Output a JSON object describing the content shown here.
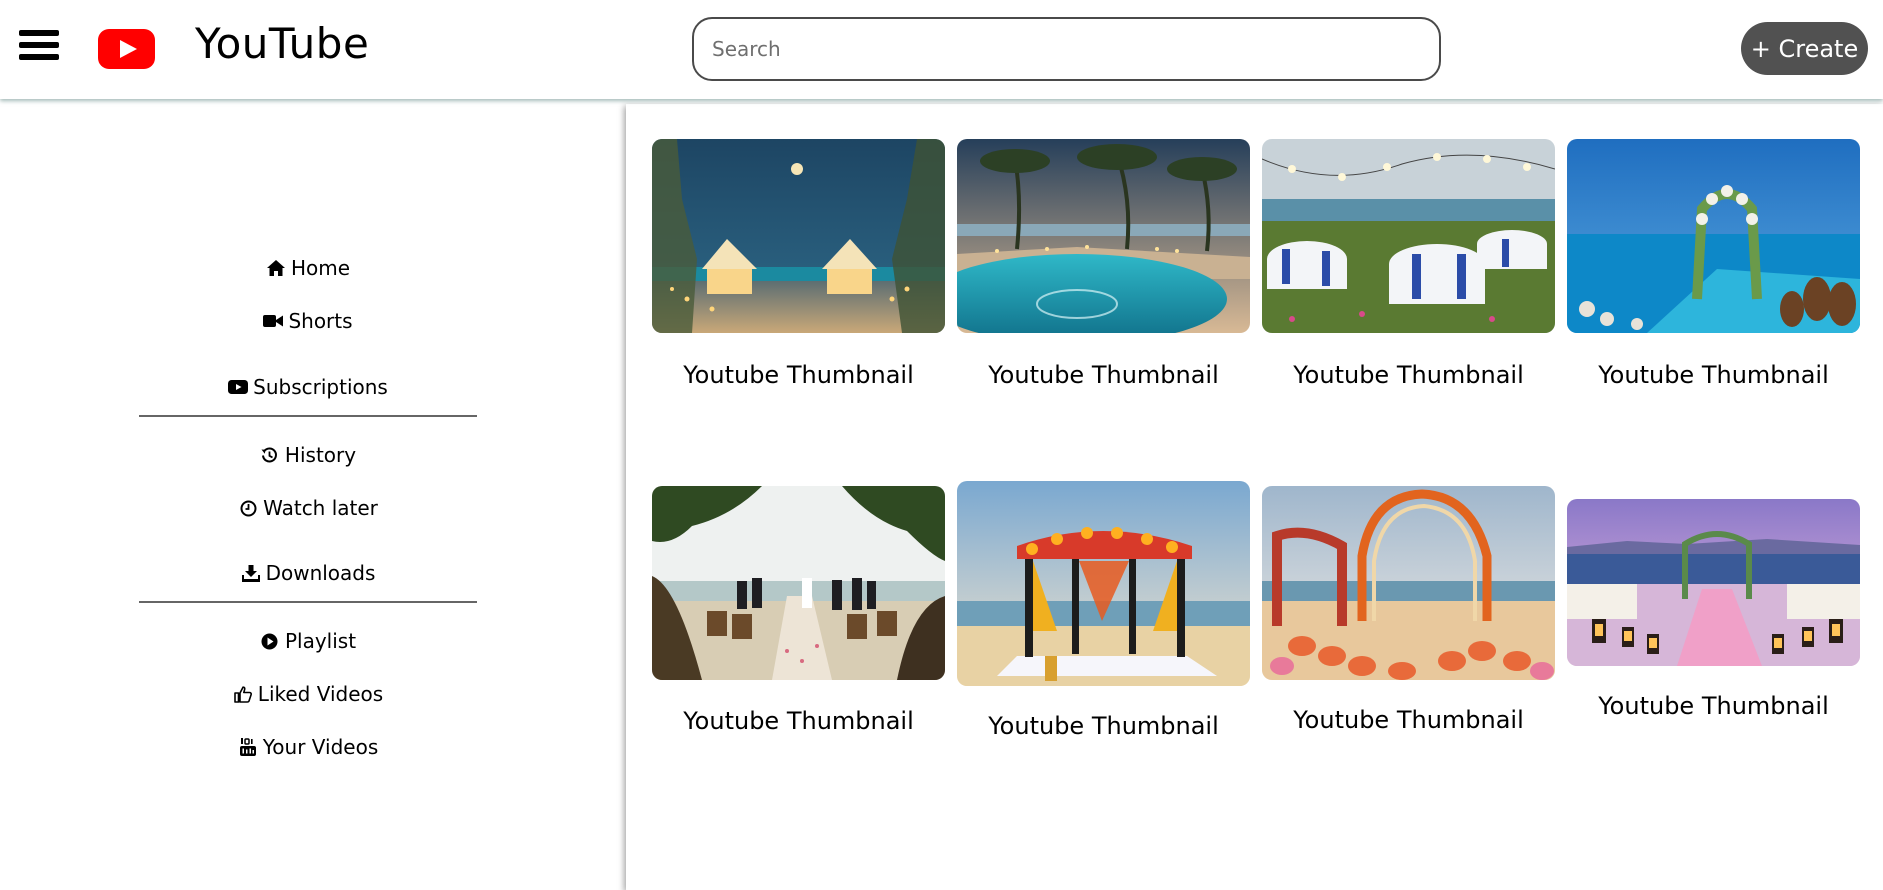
{
  "header": {
    "brand": "YouTube",
    "search_placeholder": "Search",
    "search_value": "",
    "create_label": "+ Create"
  },
  "sidebar": {
    "items": [
      {
        "label": "Home",
        "icon": "home-icon"
      },
      {
        "label": "Shorts",
        "icon": "video-camera-icon"
      },
      {
        "label": "Subscriptions",
        "icon": "youtube-icon"
      },
      {
        "label": "History",
        "icon": "history-icon"
      },
      {
        "label": "Watch later",
        "icon": "clock-icon"
      },
      {
        "label": "Downloads",
        "icon": "download-icon"
      },
      {
        "label": "Playlist",
        "icon": "play-circle-icon"
      },
      {
        "label": "Liked Videos",
        "icon": "thumbs-up-icon"
      },
      {
        "label": "Your Videos",
        "icon": "youtube-square-icon"
      }
    ]
  },
  "videos": [
    {
      "title": "Youtube Thumbnail",
      "scene": "evening-ocean-gazebos"
    },
    {
      "title": "Youtube Thumbnail",
      "scene": "pool-palms-night"
    },
    {
      "title": "Youtube Thumbnail",
      "scene": "lawn-tables-lights"
    },
    {
      "title": "Youtube Thumbnail",
      "scene": "infinity-pool-floral-arch"
    },
    {
      "title": "Youtube Thumbnail",
      "scene": "beach-ceremony-palms"
    },
    {
      "title": "Youtube Thumbnail",
      "scene": "beach-mandap"
    },
    {
      "title": "Youtube Thumbnail",
      "scene": "beach-floral-arches"
    },
    {
      "title": "Youtube Thumbnail",
      "scene": "sunset-lantern-aisle"
    }
  ],
  "colors": {
    "brand_red": "#ff0000",
    "create_button": "#515151",
    "divider": "#666666"
  }
}
